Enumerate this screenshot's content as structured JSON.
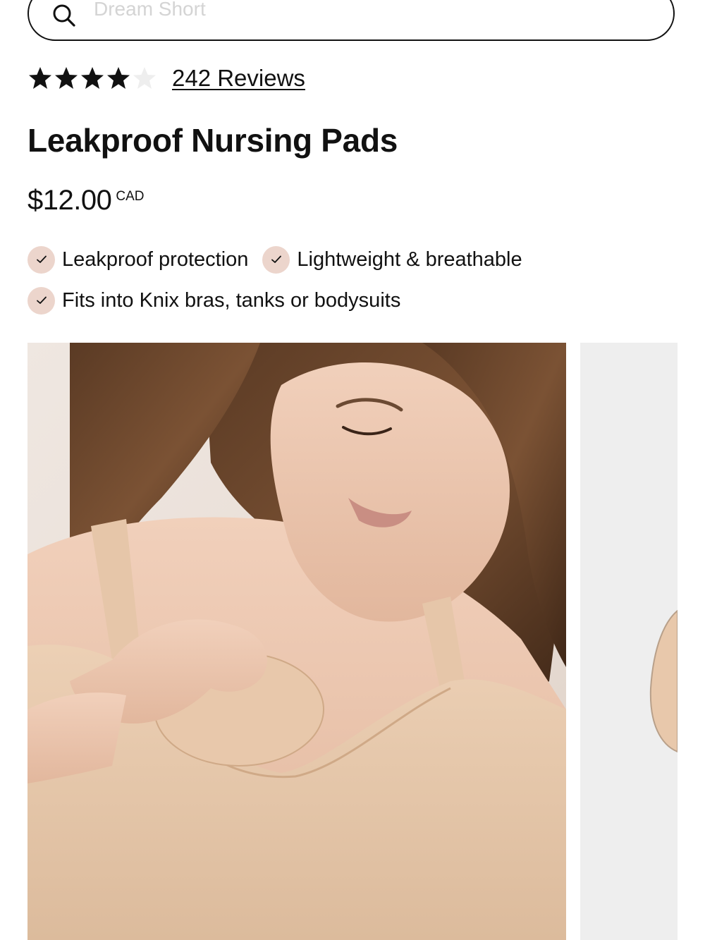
{
  "search": {
    "placeholder": "Dream Short",
    "icon": "search-icon"
  },
  "rating": {
    "value": 4,
    "max": 5,
    "reviews_label": "242 Reviews",
    "star_color": "#111111",
    "empty_star_color": "#eeeeee"
  },
  "product": {
    "title": "Leakproof Nursing Pads",
    "price": "$12.00",
    "currency": "CAD"
  },
  "features": [
    "Leakproof protection",
    "Lightweight & breathable",
    "Fits into Knix bras, tanks or bodysuits"
  ],
  "colors": {
    "check_badge": "#ecd5cc",
    "text": "#111111"
  },
  "gallery": {
    "images": [
      {
        "name": "model-wearing-nursing-bra-with-pad"
      },
      {
        "name": "nursing-pad-product-shot"
      }
    ]
  }
}
